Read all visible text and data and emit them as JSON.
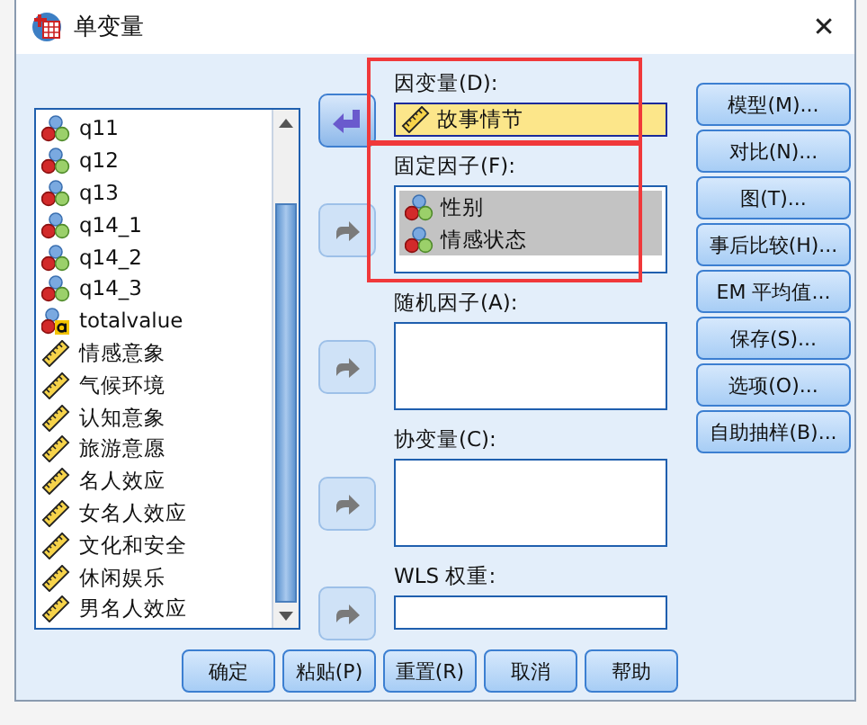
{
  "window": {
    "title": "单变量",
    "close": "✕"
  },
  "variables": [
    {
      "name": "q11",
      "kind": "nominal"
    },
    {
      "name": "q12",
      "kind": "nominal"
    },
    {
      "name": "q13",
      "kind": "nominal"
    },
    {
      "name": "q14_1",
      "kind": "nominal"
    },
    {
      "name": "q14_2",
      "kind": "nominal"
    },
    {
      "name": "q14_3",
      "kind": "nominal"
    },
    {
      "name": "totalvalue",
      "kind": "string"
    },
    {
      "name": "情感意象",
      "kind": "scale"
    },
    {
      "name": "气候环境",
      "kind": "scale"
    },
    {
      "name": "认知意象",
      "kind": "scale"
    },
    {
      "name": "旅游意愿",
      "kind": "scale"
    },
    {
      "name": "名人效应",
      "kind": "scale"
    },
    {
      "name": "女名人效应",
      "kind": "scale"
    },
    {
      "name": "文化和安全",
      "kind": "scale"
    },
    {
      "name": "休闲娱乐",
      "kind": "scale"
    },
    {
      "name": "男名人效应",
      "kind": "scale"
    }
  ],
  "targets": [
    {
      "label": "因变量(D):",
      "kind": "single",
      "arrow_enabled": true,
      "highlighted": true,
      "annotated": true,
      "items": [
        {
          "name": "故事情节",
          "kind": "scale",
          "selected": false
        }
      ]
    },
    {
      "label": "固定因子(F):",
      "kind": "multi",
      "arrow_enabled": false,
      "highlighted": false,
      "annotated": true,
      "items": [
        {
          "name": "性别",
          "kind": "nominal",
          "selected": true
        },
        {
          "name": "情感状态",
          "kind": "nominal",
          "selected": true
        }
      ]
    },
    {
      "label": "随机因子(A):",
      "kind": "multi",
      "arrow_enabled": false,
      "highlighted": false,
      "annotated": false
    },
    {
      "label": "协变量(C):",
      "kind": "multi",
      "arrow_enabled": false,
      "highlighted": false,
      "annotated": false
    },
    {
      "label": "WLS 权重:",
      "kind": "single",
      "arrow_enabled": false,
      "highlighted": false,
      "annotated": false
    }
  ],
  "side_buttons": [
    "模型(M)...",
    "对比(N)...",
    "图(T)...",
    "事后比较(H)...",
    "EM 平均值...",
    "保存(S)...",
    "选项(O)...",
    "自助抽样(B)..."
  ],
  "footer_buttons": [
    "确定",
    "粘贴(P)",
    "重置(R)",
    "取消",
    "帮助"
  ]
}
